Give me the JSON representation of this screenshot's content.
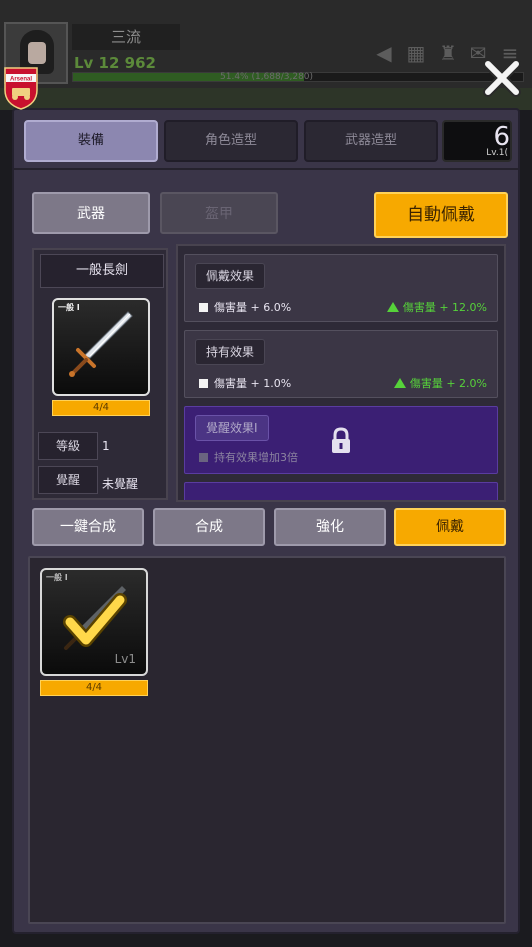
{
  "background": {
    "player_name": "三流",
    "player_level": "Lv 12 962",
    "exp_text": "51.4% (1,688/3,280)",
    "exp_progress": 0.514
  },
  "crest": {
    "team": "Arsenal"
  },
  "tabs": [
    {
      "label": "裝備",
      "active": true
    },
    {
      "label": "角色造型",
      "active": false
    },
    {
      "label": "武器造型",
      "active": false
    },
    {
      "label": "6",
      "sublabel": "Lv.1(",
      "active": false
    }
  ],
  "sub_tabs": {
    "weapon": "武器",
    "armor": "盔甲"
  },
  "auto_equip_label": "自動佩戴",
  "item": {
    "name": "一般長劍",
    "rarity": "一般 I",
    "count": "4/4",
    "level_label": "等級",
    "level_value": "1",
    "awaken_label": "覺醒",
    "awaken_value": "未覺醒"
  },
  "effects": {
    "equip": {
      "title": "佩戴效果",
      "stat": "傷害量 + 6.0%",
      "gain": "傷害量 + 12.0%"
    },
    "hold": {
      "title": "持有效果",
      "stat": "傷害量 + 1.0%",
      "gain": "傷害量 + 2.0%"
    },
    "awaken": {
      "title": "覺醒效果I",
      "stat": "持有效果增加3倍",
      "locked": true
    }
  },
  "actions": {
    "one_click_merge": "一鍵合成",
    "merge": "合成",
    "enhance": "強化",
    "equip": "佩戴"
  },
  "inventory": [
    {
      "rarity": "一般 I",
      "level": "Lv1",
      "count": "4/4",
      "equipped": true
    }
  ],
  "colors": {
    "accent_gold": "#f7a900",
    "panel": "#3a3548",
    "gain_green": "#56d23a",
    "locked_purple": "#3b1f74"
  }
}
